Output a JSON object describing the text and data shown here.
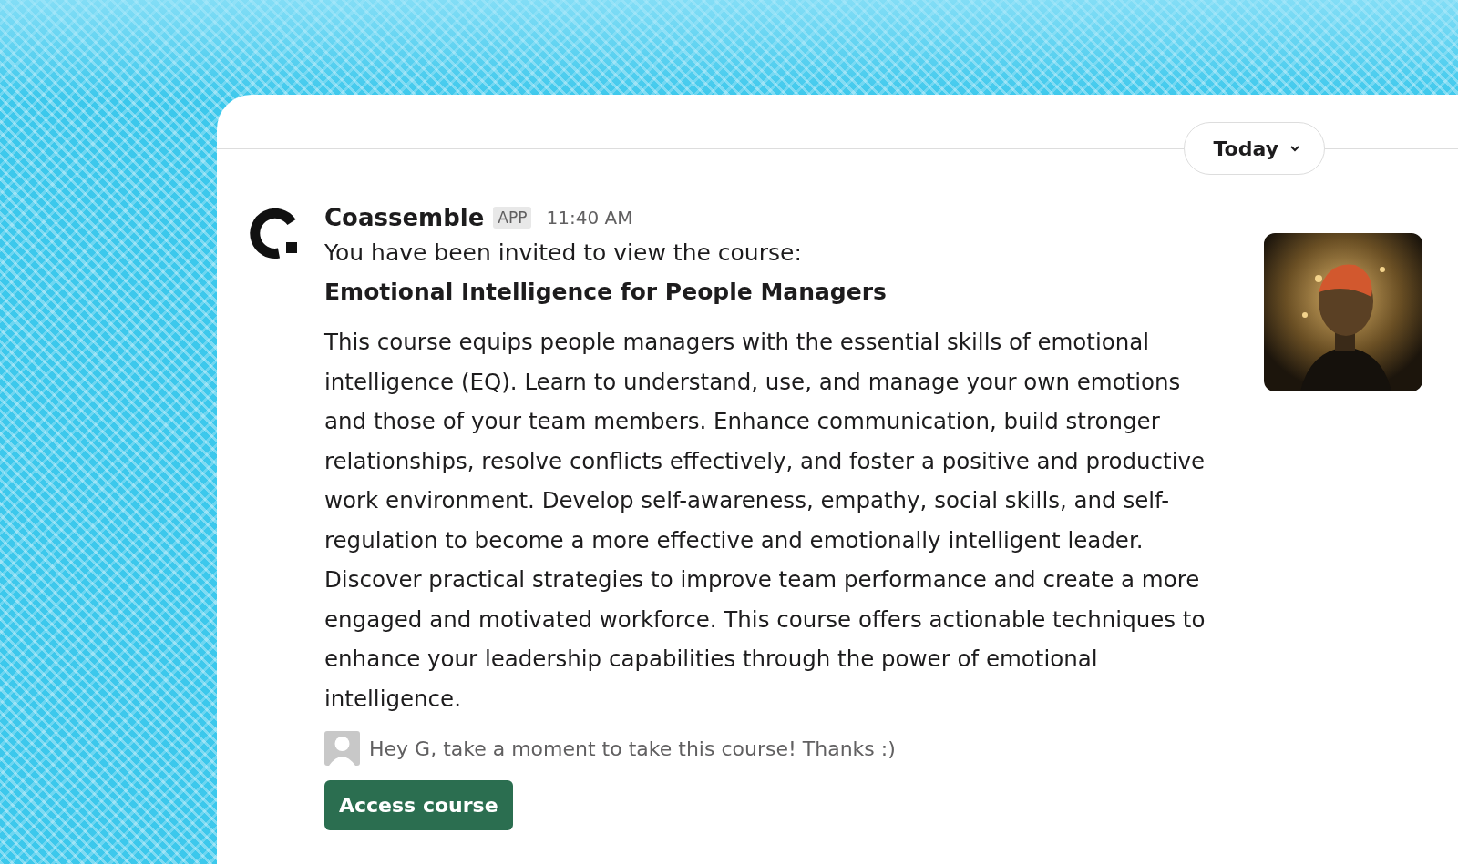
{
  "date_divider": {
    "label": "Today"
  },
  "message": {
    "sender": "Coassemble",
    "badge": "APP",
    "time": "11:40 AM",
    "intro": "You have been invited to view the course:",
    "course_title": "Emotional Intelligence for People Managers",
    "description": "This course equips people managers with the essential skills of emotional intelligence (EQ). Learn to understand, use, and manage your own emotions and those of your team members. Enhance communication, build stronger relationships, resolve conflicts effectively, and foster a positive and productive work environment. Develop self-awareness, empathy, social skills, and self-regulation to become a more effective and emotionally intelligent leader. Discover practical strategies to improve team performance and create a more engaged and motivated workforce. This course offers actionable techniques to enhance your leadership capabilities through the power of emotional intelligence.",
    "note": "Hey G, take a moment to take this course! Thanks :)",
    "button": "Access course"
  }
}
